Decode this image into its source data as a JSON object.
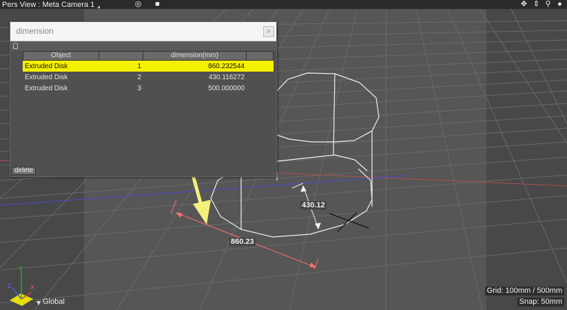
{
  "viewport": {
    "title": "Pers View : Meta Camera 1",
    "icons": [
      "target-icon",
      "cube-icon",
      "move-icon",
      "zoom-icon",
      "search-icon",
      "shading-icon"
    ]
  },
  "dialog": {
    "title": "dimension",
    "close_symbol": "×",
    "table": {
      "headers": [
        "Object",
        "",
        "dimension(mm)",
        ""
      ],
      "rows": [
        {
          "object": "Extruded Disk",
          "index": "1",
          "dimension": "860.232544",
          "selected": true
        },
        {
          "object": "Extruded Disk",
          "index": "2",
          "dimension": "430.116272",
          "selected": false
        },
        {
          "object": "Extruded Disk",
          "index": "3",
          "dimension": "500.000000",
          "selected": false
        }
      ]
    },
    "delete_label": "delete"
  },
  "scene": {
    "dimension_labels": [
      "430.12",
      "860.23"
    ],
    "axis_mode": "Global",
    "grid_label": "Grid: 100mm / 500mm",
    "snap_label": "Snap: 50mm",
    "colors": {
      "highlight": "#f5f000",
      "arrow": "#f4f07a",
      "measure": "#ff7070"
    }
  }
}
